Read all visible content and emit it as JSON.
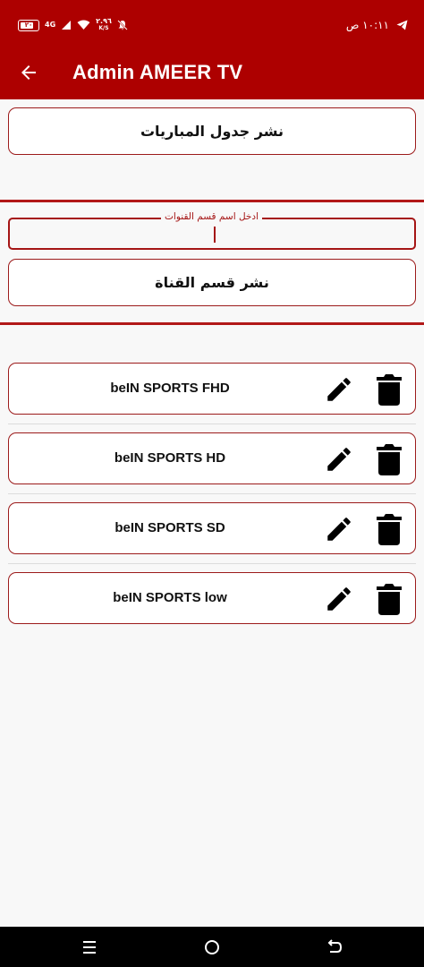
{
  "status_bar": {
    "time": "١٠:١١ ص",
    "battery": "٢٠",
    "network": "4G",
    "speed_value": "٢.٩٦",
    "speed_unit": "K/S"
  },
  "app_bar": {
    "title": "Admin AMEER TV"
  },
  "matches": {
    "publish_schedule_label": "نشر جدول المباريات"
  },
  "category_form": {
    "field_label": "ادخل اسم قسم القنوات",
    "field_value": "",
    "publish_label": "نشر قسم القناة"
  },
  "channels": [
    {
      "name": "beIN SPORTS FHD"
    },
    {
      "name": "beIN SPORTS HD"
    },
    {
      "name": "beIN SPORTS SD"
    },
    {
      "name": "beIN SPORTS low"
    }
  ],
  "colors": {
    "primary": "#ad0000",
    "accent_border": "#9c1b1b",
    "background": "#f8f8f8"
  },
  "icons": {
    "back": "arrow-back-icon",
    "edit": "pencil-icon",
    "delete": "trash-icon"
  }
}
